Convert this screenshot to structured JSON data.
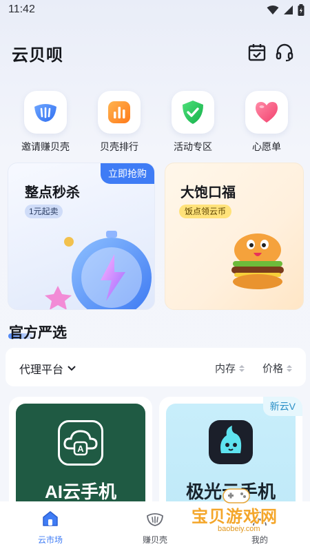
{
  "status_bar": {
    "time": "11:42"
  },
  "header": {
    "title": "云贝呗"
  },
  "quick_menu": [
    {
      "label": "邀请赚贝壳",
      "icon": "shell-icon"
    },
    {
      "label": "贝壳排行",
      "icon": "bar-chart-icon"
    },
    {
      "label": "活动专区",
      "icon": "shield-check-icon"
    },
    {
      "label": "心愿单",
      "icon": "heart-icon"
    }
  ],
  "promos": {
    "left": {
      "title": "整点秒杀",
      "pill": "1元起卖",
      "badge": "立即抢购"
    },
    "right": {
      "title": "大饱口福",
      "pill": "饭点领云币"
    }
  },
  "section": {
    "title": "官方严选"
  },
  "filters": {
    "platform": "代理平台",
    "sort_memory": "内存",
    "sort_price": "价格"
  },
  "products": [
    {
      "name": "AI云手机",
      "logo_letter": "A"
    },
    {
      "name": "极光云手机",
      "badge": "新云V"
    }
  ],
  "bottom_nav": [
    {
      "label": "云市场",
      "active": true
    },
    {
      "label": "赚贝壳",
      "active": false
    },
    {
      "label": "我的",
      "active": false
    }
  ],
  "watermark": {
    "text": "宝贝游戏网",
    "url": "baobeiy.com"
  },
  "colors": {
    "accent": "#3f7cf5",
    "green": "#1f5a43",
    "orange": "#f4a62a"
  }
}
